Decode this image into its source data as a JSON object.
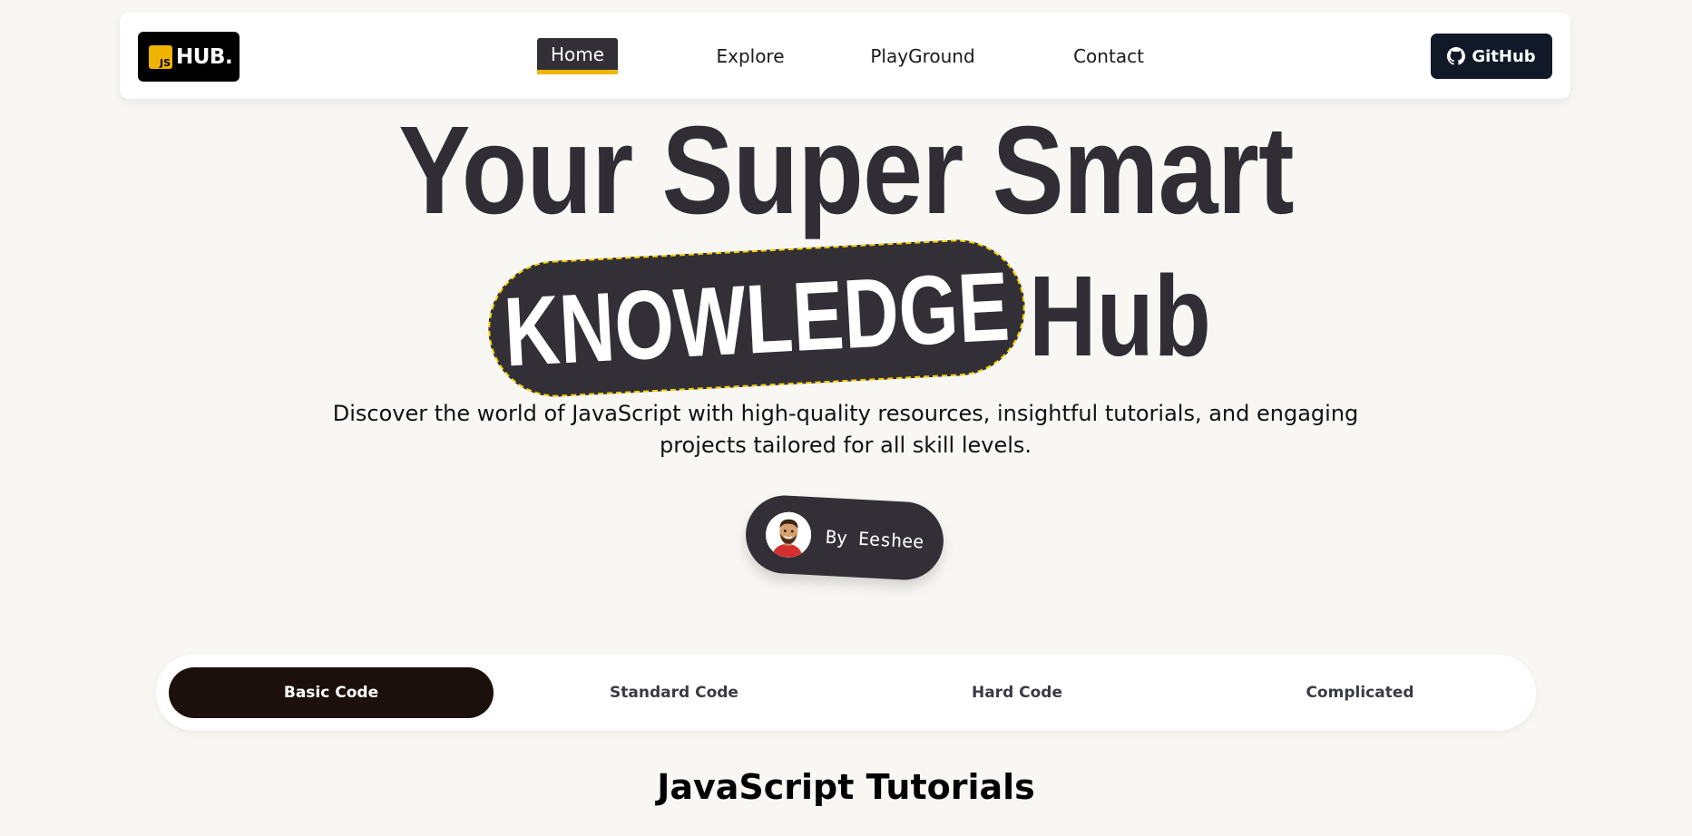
{
  "navbar": {
    "logo": {
      "badge": "JS",
      "text": "HUB."
    },
    "items": [
      {
        "label": "Home",
        "active": true
      },
      {
        "label": "Explore",
        "active": false
      },
      {
        "label": "PlayGround",
        "active": false
      },
      {
        "label": "Contact",
        "active": false
      }
    ],
    "github_label": "GitHub"
  },
  "hero": {
    "line1": "Your Super Smart",
    "highlight": "KNOWLEDGE",
    "line2_rest": "Hub",
    "description": "Discover the world of JavaScript with high-quality resources, insightful tutorials, and engaging projects tailored for all skill levels.",
    "author": "By Eeshee"
  },
  "tabs": [
    {
      "label": "Basic Code",
      "active": true
    },
    {
      "label": "Standard Code",
      "active": false
    },
    {
      "label": "Hard Code",
      "active": false
    },
    {
      "label": "Complicated",
      "active": false
    }
  ],
  "section": {
    "title": "JavaScript Tutorials"
  },
  "colors": {
    "accent": "#f0b400",
    "dark": "#332f37",
    "background": "#f8f7f3",
    "active_tab": "#1c100c"
  }
}
